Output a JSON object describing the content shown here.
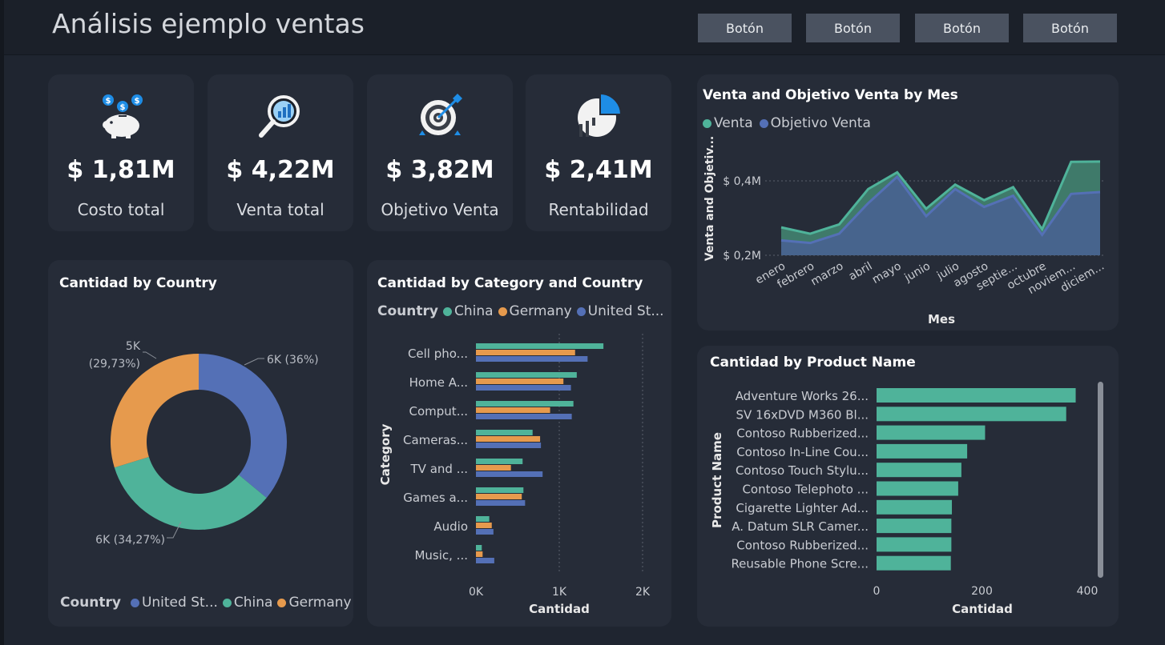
{
  "header": {
    "title": "Análisis ejemplo ventas",
    "buttons": [
      "Botón",
      "Botón",
      "Botón",
      "Botón"
    ]
  },
  "kpis": [
    {
      "value": "$ 1,81M",
      "label": "Costo total",
      "icon": "piggy-bank-icon"
    },
    {
      "value": "$ 4,22M",
      "label": "Venta total",
      "icon": "magnifier-chart-icon"
    },
    {
      "value": "$ 3,82M",
      "label": "Objetivo Venta",
      "icon": "target-icon"
    },
    {
      "value": "$ 2,41M",
      "label": "Rentabilidad",
      "icon": "pie-chart-icon"
    }
  ],
  "colors": {
    "teal": "#4fb39a",
    "blue": "#5470b6",
    "orange": "#e69a4d"
  },
  "chart_data": [
    {
      "id": "donut",
      "type": "pie",
      "title": "Cantidad by Country",
      "legend_title": "Country",
      "legend": [
        "United St...",
        "China",
        "Germany"
      ],
      "slices": [
        {
          "name": "United States",
          "value": 36.0,
          "label": "6K (36%)",
          "color": "#5470b6"
        },
        {
          "name": "China",
          "value": 34.27,
          "label": "6K (34,27%)",
          "color": "#4fb39a"
        },
        {
          "name": "Germany",
          "value": 29.73,
          "label": "5K\n(29,73%)",
          "color": "#e69a4d"
        }
      ]
    },
    {
      "id": "category",
      "type": "bar",
      "orientation": "horizontal",
      "title": "Cantidad by Category and Country",
      "legend_title": "Country",
      "legend": [
        "China",
        "Germany",
        "United St..."
      ],
      "categories": [
        "Cell pho...",
        "Home A...",
        "Comput...",
        "Cameras...",
        "TV and ...",
        "Games a...",
        "Audio",
        "Music, ..."
      ],
      "series": [
        {
          "name": "China",
          "color": "#4fb39a",
          "values": [
            1530,
            1210,
            1170,
            680,
            560,
            570,
            160,
            70
          ]
        },
        {
          "name": "Germany",
          "color": "#e69a4d",
          "values": [
            1190,
            1050,
            890,
            770,
            420,
            550,
            190,
            80
          ]
        },
        {
          "name": "United States",
          "color": "#5470b6",
          "values": [
            1340,
            1140,
            1150,
            780,
            800,
            590,
            210,
            220
          ]
        }
      ],
      "xticks": [
        "0K",
        "1K",
        "2K"
      ],
      "xlim": [
        0,
        2000
      ],
      "xlabel": "Cantidad",
      "ylabel": "Category"
    },
    {
      "id": "area",
      "type": "area",
      "title": "Venta and Objetivo Venta by Mes",
      "legend": [
        "Venta",
        "Objetivo Venta"
      ],
      "categories": [
        "enero",
        "febrero",
        "marzo",
        "abril",
        "mayo",
        "junio",
        "julio",
        "agosto",
        "septie...",
        "octubre",
        "noviem...",
        "diciem..."
      ],
      "series": [
        {
          "name": "Venta",
          "color": "#4fb39a",
          "values": [
            0.275,
            0.258,
            0.283,
            0.378,
            0.423,
            0.325,
            0.39,
            0.348,
            0.383,
            0.27,
            0.451,
            0.452
          ]
        },
        {
          "name": "Objetivo Venta",
          "color": "#5470b6",
          "values": [
            0.24,
            0.233,
            0.258,
            0.34,
            0.411,
            0.305,
            0.378,
            0.33,
            0.36,
            0.255,
            0.365,
            0.37
          ]
        }
      ],
      "yticks": [
        "$ 0,2M",
        "$ 0,4M"
      ],
      "ylim": [
        0.2,
        0.45
      ],
      "xlabel": "Mes",
      "ylabel": "Venta and Objetiv..."
    },
    {
      "id": "product",
      "type": "bar",
      "orientation": "horizontal",
      "title": "Cantidad by Product Name",
      "categories": [
        "Adventure Works 26...",
        "SV 16xDVD M360 Bl...",
        "Contoso Rubberized...",
        "Contoso In-Line Cou...",
        "Contoso Touch Stylu...",
        "Contoso Telephoto ...",
        "Cigarette Lighter Ad...",
        "A. Datum SLR Camer...",
        "Contoso Rubberized...",
        "Reusable Phone Scre..."
      ],
      "values": [
        378,
        360,
        206,
        172,
        161,
        155,
        143,
        142,
        142,
        141
      ],
      "color": "#4fb39a",
      "xticks": [
        "0",
        "200",
        "400"
      ],
      "xlim": [
        0,
        400
      ],
      "xlabel": "Cantidad",
      "ylabel": "Product Name"
    }
  ]
}
